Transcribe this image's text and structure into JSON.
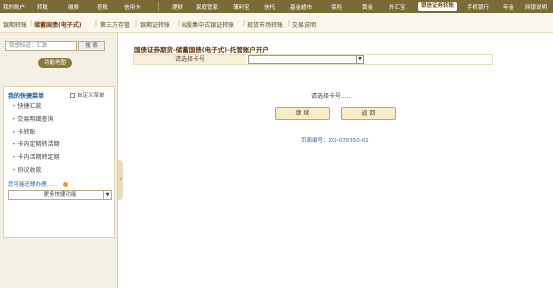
{
  "topnav": {
    "items": [
      {
        "label": "我的账户"
      },
      {
        "label": "转账"
      },
      {
        "label": "缴费"
      },
      {
        "label": "查账"
      },
      {
        "label": "信用卡"
      },
      {
        "label": "理财"
      },
      {
        "label": "家庭管家"
      },
      {
        "label": "薄利宝"
      },
      {
        "label": "信托"
      },
      {
        "label": "基金超市"
      },
      {
        "label": "保险"
      },
      {
        "label": "黄金"
      },
      {
        "label": "外汇宝"
      },
      {
        "label": "银信证券转账"
      },
      {
        "label": "手机银行"
      },
      {
        "label": "年金"
      },
      {
        "label": "网银说明"
      }
    ]
  },
  "subnav": {
    "items": [
      {
        "label": "银期转账"
      },
      {
        "label": "储蓄国债(电子式)"
      },
      {
        "label": "第三方存管"
      },
      {
        "label": "银期证转账"
      },
      {
        "label": "B股集中式银证转账"
      },
      {
        "label": "现货市场转账"
      },
      {
        "label": "交易说明"
      }
    ],
    "separator": "|"
  },
  "sidebar": {
    "search_placeholder": "我想知道：汇款",
    "search_button": "搜 索",
    "map_button": "功能地图",
    "quick_menu": {
      "title": "我的快捷菜单",
      "custom_label": "自定义菜单",
      "items": [
        {
          "label": "快捷汇款"
        },
        {
          "label": "交易明细查询"
        },
        {
          "label": "卡转账"
        },
        {
          "label": "卡内定期转活期"
        },
        {
          "label": "卡内活期转定期"
        },
        {
          "label": "协议收款"
        }
      ],
      "hint": "您可能还想办理......",
      "more_select": "更多快捷功能"
    }
  },
  "main": {
    "title": "国债证券期货-储蓄国债(电子式)-托管账户开户",
    "form": {
      "label": "请选择卡号",
      "select_value": ""
    },
    "hint": "请选择卡号......",
    "continue_button": "继 续",
    "back_button": "返 回",
    "page_code": "页面编号：ZQ-070350-01"
  },
  "colors": {
    "topnav_bg": "#7a6a35",
    "accent": "#1a5a9a",
    "button_bg": "#f8ecc8"
  }
}
